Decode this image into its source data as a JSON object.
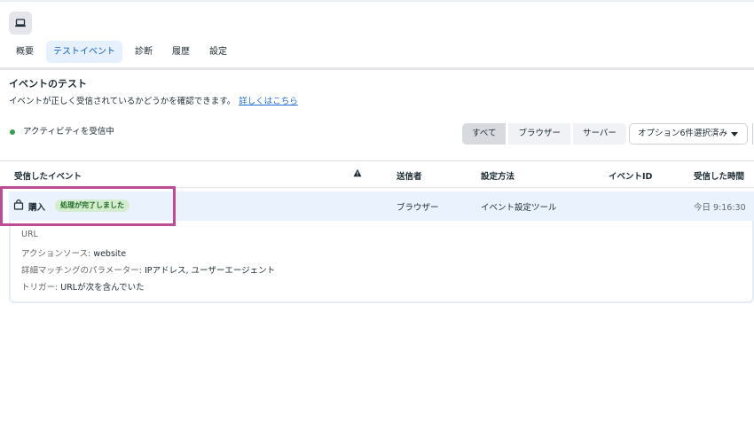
{
  "tabs": [
    {
      "label": "概要",
      "active": false
    },
    {
      "label": "テストイベント",
      "active": true
    },
    {
      "label": "診断",
      "active": false
    },
    {
      "label": "履歴",
      "active": false
    },
    {
      "label": "設定",
      "active": false
    }
  ],
  "section": {
    "title": "イベントのテスト",
    "description": "イベントが正しく受信されているかどうかを確認できます。",
    "learn_more": "詳しくはこちら"
  },
  "status": {
    "text": "アクティビティを受信中",
    "color": "#31a24c"
  },
  "filters": {
    "buttons": [
      "すべて",
      "ブラウザー",
      "サーバー"
    ],
    "selected": "すべて",
    "options_label": "オプション6件選択済み"
  },
  "table": {
    "headers": {
      "event": "受信したイベント",
      "sender": "送信者",
      "method": "設定方法",
      "event_id": "イベントID",
      "received_time": "受信した時間"
    },
    "rows": [
      {
        "event": "購入",
        "badge": "処理が完了しました",
        "sender": "ブラウザー",
        "method": "イベント設定ツール",
        "event_id": "",
        "received_time": "今日 9:16:30",
        "details": {
          "url_label": "URL",
          "action_source_label": "アクションソース:",
          "action_source_value": "website",
          "matching_label": "詳細マッチングのパラメーター:",
          "matching_value": "IPアドレス, ユーザーエージェント",
          "trigger_label": "トリガー:",
          "trigger_value": "URLが次を含んでいた"
        }
      }
    ]
  },
  "colors": {
    "accent": "#0a5fc7",
    "link": "#216fdb",
    "highlight": "#bd4b97",
    "badge_bg": "#d4edcf"
  }
}
